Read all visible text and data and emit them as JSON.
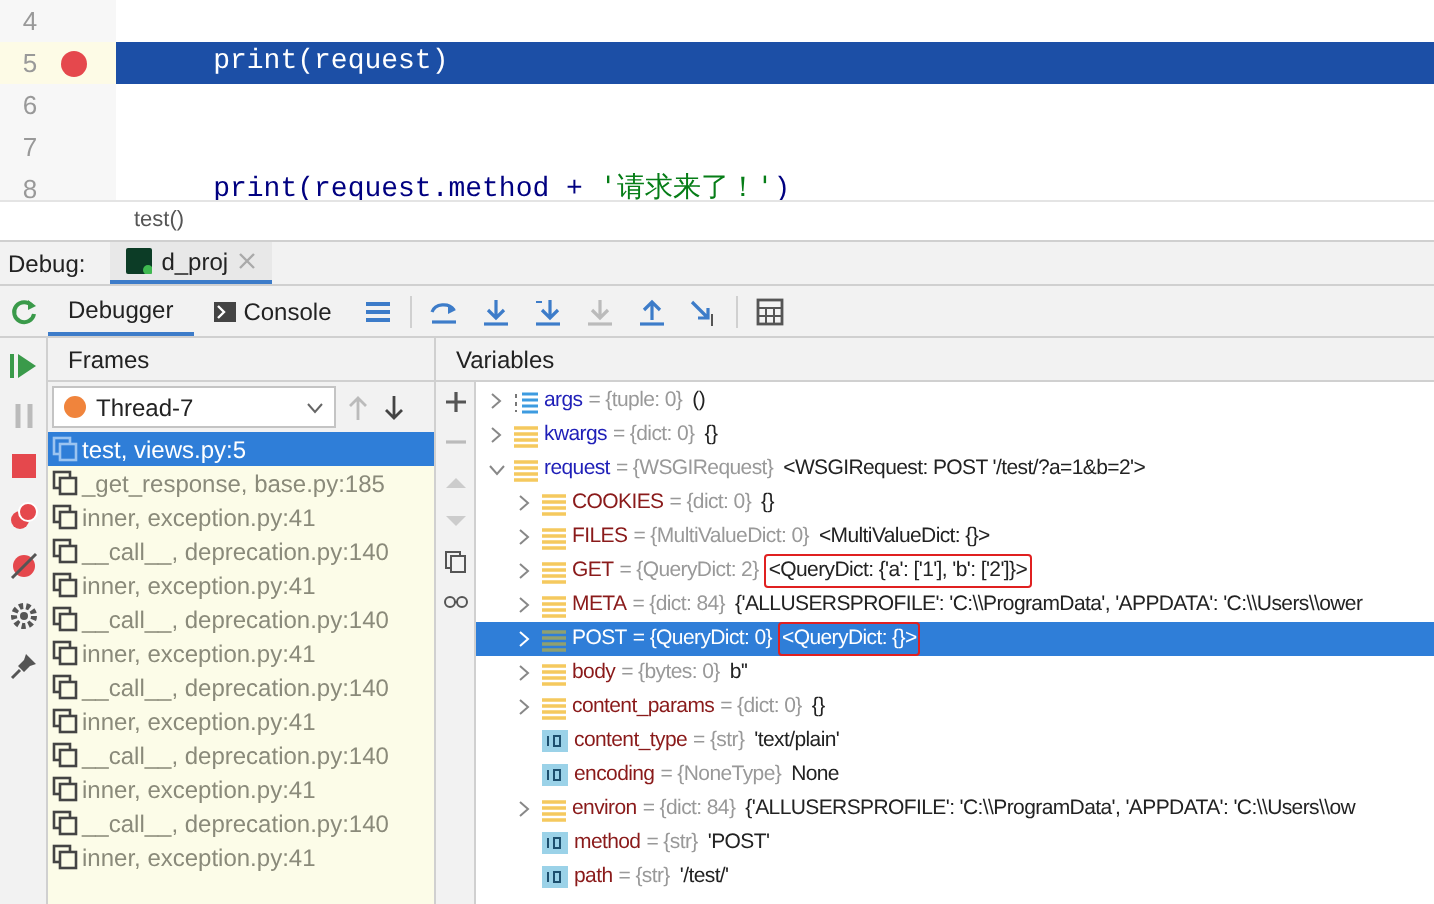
{
  "editor": {
    "lines": [
      {
        "number": "4",
        "breakpoint": false,
        "selected": false
      },
      {
        "number": "5",
        "code": "    print(request)",
        "breakpoint": true,
        "selected": true
      },
      {
        "number": "6",
        "breakpoint": false,
        "selected": false
      },
      {
        "number": "7",
        "breakpoint": false,
        "selected": false
      },
      {
        "number": "8",
        "code": "    print(request.method + ",
        "string": "'请求来了！'",
        "tail": ")",
        "breakpoint": false,
        "selected": false
      }
    ],
    "breadcrumb": "test()"
  },
  "debug": {
    "label": "Debug:",
    "tabs": [
      {
        "label": "d_proj",
        "selected": true
      }
    ]
  },
  "toolbar": {
    "tabs": [
      {
        "label": "Debugger",
        "selected": true
      },
      {
        "label": "Console",
        "selected": false
      }
    ]
  },
  "frames": {
    "title": "Frames",
    "thread": "Thread-7",
    "items": [
      {
        "label": "test, views.py:5",
        "selected": true
      },
      {
        "label": "_get_response, base.py:185",
        "selected": false
      },
      {
        "label": "inner, exception.py:41",
        "selected": false
      },
      {
        "label": "__call__, deprecation.py:140",
        "selected": false
      },
      {
        "label": "inner, exception.py:41",
        "selected": false
      },
      {
        "label": "__call__, deprecation.py:140",
        "selected": false
      },
      {
        "label": "inner, exception.py:41",
        "selected": false
      },
      {
        "label": "__call__, deprecation.py:140",
        "selected": false
      },
      {
        "label": "inner, exception.py:41",
        "selected": false
      },
      {
        "label": "__call__, deprecation.py:140",
        "selected": false
      },
      {
        "label": "inner, exception.py:41",
        "selected": false
      },
      {
        "label": "__call__, deprecation.py:140",
        "selected": false
      },
      {
        "label": "inner, exception.py:41",
        "selected": false
      }
    ]
  },
  "variables": {
    "title": "Variables",
    "items": [
      {
        "kind": "tuple",
        "name": "args",
        "type": "= {tuple: 0}",
        "value": "()",
        "expanded": false,
        "selected": false,
        "boxed": false
      },
      {
        "kind": "dict",
        "name": "kwargs",
        "type": "= {dict: 0}",
        "value": "{}",
        "expanded": false,
        "selected": false,
        "boxed": false
      },
      {
        "kind": "dict",
        "name": "request",
        "type": "= {WSGIRequest}",
        "value": "<WSGIRequest: POST '/test/?a=1&b=2'>",
        "expanded": true,
        "selected": false,
        "boxed": false,
        "children": [
          {
            "kind": "dict",
            "name": "COOKIES",
            "type": "= {dict: 0}",
            "value": "{}",
            "expanded": false,
            "selected": false,
            "boxed": false
          },
          {
            "kind": "dict",
            "name": "FILES",
            "type": "= {MultiValueDict: 0}",
            "value": "<MultiValueDict: {}>",
            "expanded": false,
            "selected": false,
            "boxed": false
          },
          {
            "kind": "dict",
            "name": "GET",
            "type": "= {QueryDict: 2}",
            "value": "<QueryDict: {'a': ['1'], 'b': ['2']}>",
            "expanded": false,
            "selected": false,
            "boxed": true
          },
          {
            "kind": "dict",
            "name": "META",
            "type": "= {dict: 84}",
            "value": "{'ALLUSERSPROFILE': 'C:\\\\ProgramData', 'APPDATA': 'C:\\\\Users\\\\ower",
            "expanded": false,
            "selected": false,
            "boxed": false
          },
          {
            "kind": "dict",
            "name": "POST",
            "type": "= {QueryDict: 0}",
            "value": "<QueryDict: {}>",
            "expanded": false,
            "selected": true,
            "boxed": true
          },
          {
            "kind": "dict",
            "name": "body",
            "type": "= {bytes: 0}",
            "value": "b''",
            "expanded": false,
            "selected": false,
            "boxed": false
          },
          {
            "kind": "dict",
            "name": "content_params",
            "type": "= {dict: 0}",
            "value": "{}",
            "expanded": false,
            "selected": false,
            "boxed": false
          },
          {
            "kind": "str",
            "name": "content_type",
            "type": "= {str}",
            "value": "'text/plain'",
            "selected": false,
            "boxed": false
          },
          {
            "kind": "str",
            "name": "encoding",
            "type": "= {NoneType}",
            "value": "None",
            "selected": false,
            "boxed": false
          },
          {
            "kind": "dict",
            "name": "environ",
            "type": "= {dict: 84}",
            "value": "{'ALLUSERSPROFILE': 'C:\\\\ProgramData', 'APPDATA': 'C:\\\\Users\\\\ow",
            "expanded": false,
            "selected": false,
            "boxed": false
          },
          {
            "kind": "str",
            "name": "method",
            "type": "= {str}",
            "value": "'POST'",
            "selected": false,
            "boxed": false
          },
          {
            "kind": "str",
            "name": "path",
            "type": "= {str}",
            "value": "'/test/'",
            "selected": false,
            "boxed": false
          }
        ]
      }
    ]
  }
}
